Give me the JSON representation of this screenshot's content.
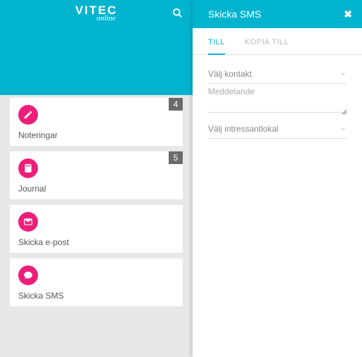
{
  "brand": {
    "main": "VITEC",
    "sub": "online"
  },
  "cards": [
    {
      "label": "Noteringar",
      "badge": "4"
    },
    {
      "label": "Journal",
      "badge": "5"
    },
    {
      "label": "Skicka e-post",
      "badge": null
    },
    {
      "label": "Skicka SMS",
      "badge": null
    }
  ],
  "panel": {
    "title": "Skicka SMS",
    "tabs": {
      "till": "TILL",
      "kopia": "KOPIA TILL"
    },
    "drop_contact": "Välj kontakt",
    "msg_placeholder": "Meddelande",
    "drop_interest": "Välj intressantlokal"
  }
}
